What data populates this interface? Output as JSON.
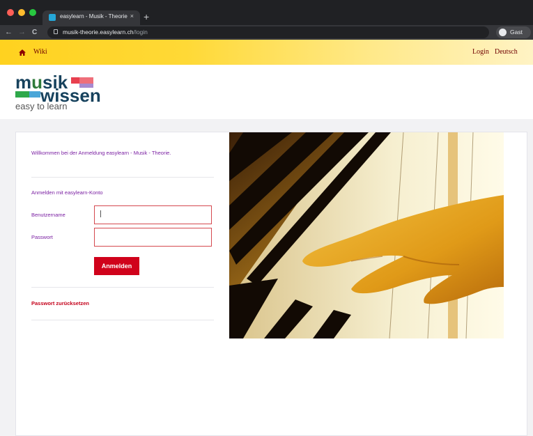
{
  "browser": {
    "tab_title": "easylearn - Musik - Theorie",
    "tab_close": "×",
    "new_tab": "+",
    "url_host": "musik-theorie.easylearn.ch",
    "url_path": "/login",
    "profile_label": "Gast",
    "nav_back": "←",
    "nav_forward": "→",
    "nav_reload": "C"
  },
  "sitenav": {
    "wiki": "Wiki",
    "login": "Login",
    "language": "Deutsch"
  },
  "logo": {
    "line1_a": "m",
    "line1_b": "u",
    "line1_c": "sik",
    "line2": "wissen",
    "tagline": "easy to learn"
  },
  "login": {
    "welcome": "Willkommen bei der Anmeldung easylearn - Musik - Theorie.",
    "section_title": "Anmelden mit easylearn-Konto",
    "username_label": "Benutzername",
    "password_label": "Passwort",
    "username_value": "",
    "password_value": "",
    "submit_label": "Anmelden",
    "reset_link": "Passwort zurücksetzen"
  },
  "colors": {
    "accent_purple": "#7a1fa2",
    "button_red": "#d0021b",
    "nav_yellow": "#ffd21f",
    "nav_text": "#6f0000"
  }
}
